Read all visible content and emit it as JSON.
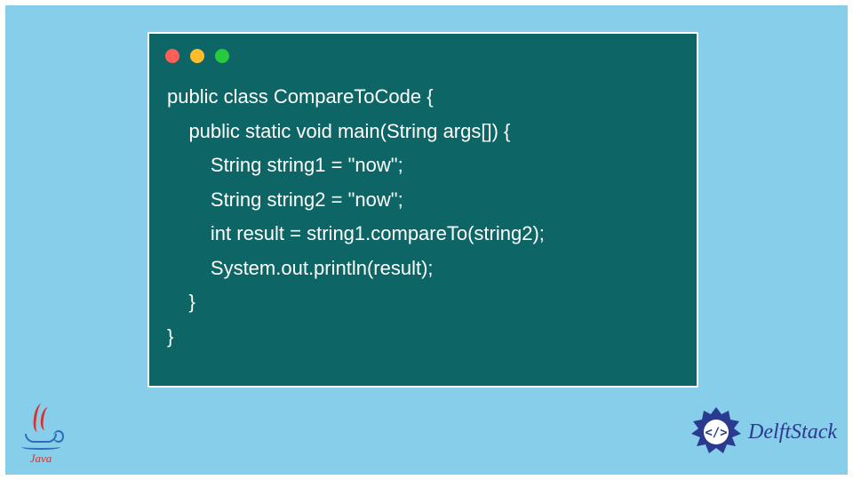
{
  "code": {
    "lines": [
      "public class CompareToCode {",
      "    public static void main(String args[]) {",
      "        String string1 = \"now\";",
      "        String string2 = \"now\";",
      "        int result = string1.compareTo(string2);",
      "        System.out.println(result);",
      "    }",
      "}"
    ]
  },
  "java_logo": {
    "label": "Java"
  },
  "delft_logo": {
    "text": "DelftStack"
  }
}
